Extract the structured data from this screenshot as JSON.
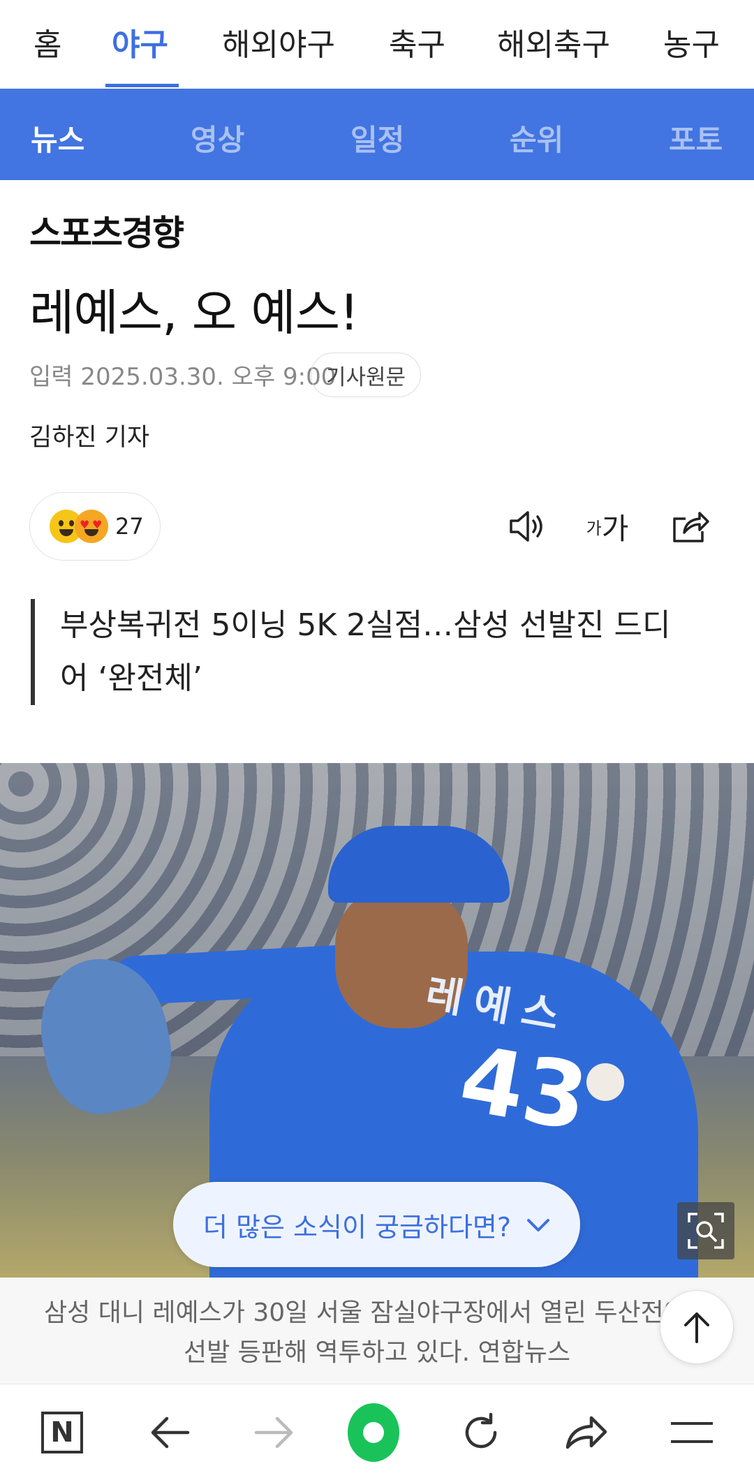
{
  "top_nav": {
    "tabs": [
      {
        "label": "홈"
      },
      {
        "label": "야구"
      },
      {
        "label": "해외야구"
      },
      {
        "label": "축구"
      },
      {
        "label": "해외축구"
      },
      {
        "label": "농구"
      }
    ],
    "active_index": 1,
    "accent_color": "#3d6fe0"
  },
  "sub_nav": {
    "tabs": [
      {
        "label": "뉴스"
      },
      {
        "label": "영상"
      },
      {
        "label": "일정"
      },
      {
        "label": "순위"
      },
      {
        "label": "포토"
      }
    ],
    "active_index": 0,
    "background_color": "#4274e2"
  },
  "article": {
    "press": "스포츠경향",
    "headline": "레예스, 오 예스!",
    "published": "입력 2025.03.30. 오후 9:00",
    "original_button": "기사원문",
    "reporter": "김하진 기자",
    "reaction_count": "27",
    "subtitle": "부상복귀전 5이닝 5K 2실점…삼성 선발진 드디어 ‘완전체’",
    "photo": {
      "jersey_name": "레예스",
      "jersey_number": "43"
    },
    "more_prompt": "더 많은 소식이 궁금하다면?",
    "caption": "삼성 대니 레예스가 30일 서울 잠실야구장에서 열린 두산전에서 선발 등판해 역투하고 있다. 연합뉴스"
  },
  "icons": {
    "reaction": [
      "smiley-icon",
      "heart-eyes-icon"
    ],
    "tools": [
      "speaker-icon",
      "font-size-icon",
      "share-icon"
    ],
    "photo": [
      "zoom-icon"
    ],
    "scroll": "arrow-up-icon",
    "bottom_bar": [
      "naver-n-icon",
      "back-arrow-icon",
      "forward-arrow-icon",
      "home-green-icon",
      "reload-icon",
      "share-arrow-icon",
      "menu-icon"
    ]
  },
  "font_size_icon": {
    "small": "가",
    "large": "가"
  }
}
